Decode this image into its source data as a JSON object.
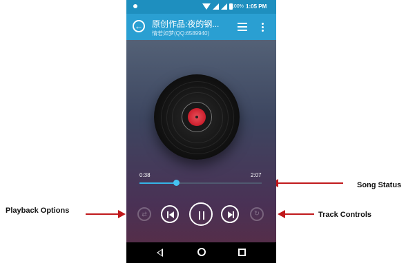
{
  "annotations": {
    "song_status": "Song Status",
    "playback_options": "Playback Options",
    "track_controls": "Track Controls"
  },
  "status_bar": {
    "battery": "100%",
    "time": "1:05 PM"
  },
  "app_bar": {
    "title": "原创作品:夜的钢...",
    "artist": "情若如梦(QQ:6589940)"
  },
  "player": {
    "elapsed": "0:38",
    "duration": "2:07",
    "progress_fraction": 0.3
  },
  "colors": {
    "accent": "#2a9fd2",
    "status_bar": "#1e8fbf",
    "progress": "#35b6e8",
    "annotation_arrow": "#c0181b",
    "record_label": "#cc1e2c"
  },
  "icons": {
    "back": "back-arrow-icon",
    "playlist": "list-icon",
    "overflow": "more-vert-icon",
    "shuffle": "shuffle-icon",
    "previous": "skip-previous-icon",
    "pause": "pause-icon",
    "next": "skip-next-icon",
    "repeat": "repeat-icon"
  }
}
